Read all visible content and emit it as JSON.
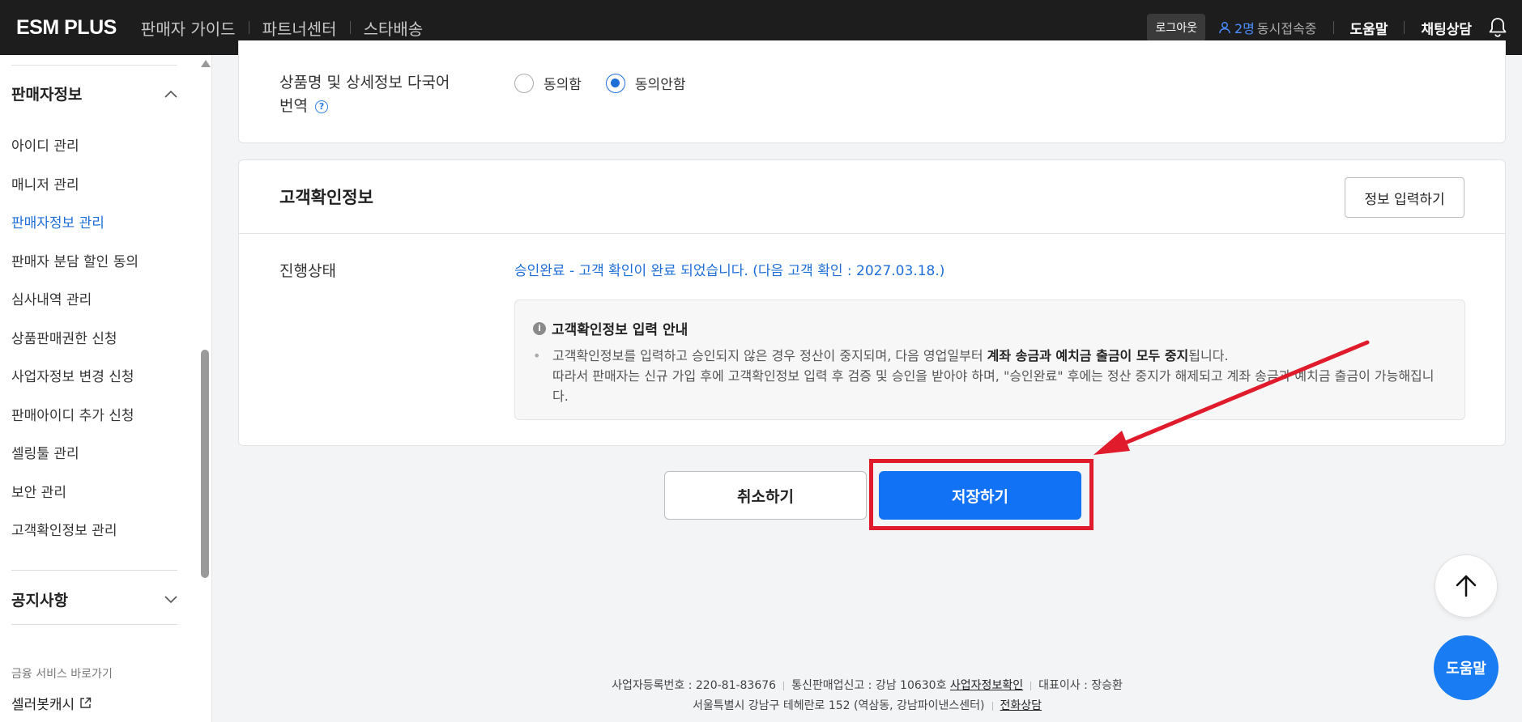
{
  "header": {
    "logo": "ESM PLUS",
    "nav": [
      "판매자 가이드",
      "파트너센터",
      "스타배송"
    ],
    "logout": "로그아웃",
    "session_count": "2명",
    "session_label": "동시접속중",
    "help": "도움말",
    "chat": "채팅상담"
  },
  "sidebar": {
    "section_title": "판매자정보",
    "items": [
      {
        "label": "아이디 관리"
      },
      {
        "label": "매니저 관리"
      },
      {
        "label": "판매자정보 관리"
      },
      {
        "label": "판매자 분담 할인 동의"
      },
      {
        "label": "심사내역 관리"
      },
      {
        "label": "상품판매권한 신청"
      },
      {
        "label": "사업자정보 변경 신청"
      },
      {
        "label": "판매아이디 추가 신청"
      },
      {
        "label": "셀링툴 관리"
      },
      {
        "label": "보안 관리"
      },
      {
        "label": "고객확인정보 관리"
      }
    ],
    "notice_title": "공지사항",
    "finance_label": "금융 서비스 바로가기",
    "finance_link": "셀러봇캐시"
  },
  "translation": {
    "label_line1": "상품명 및 상세정보 다국어",
    "label_line2": "번역",
    "options": [
      "동의함",
      "동의안함"
    ],
    "selected": "동의안함"
  },
  "customer_info": {
    "title": "고객확인정보",
    "input_button": "정보 입력하기",
    "status_label": "진행상태",
    "status_text": "승인완료 - 고객 확인이 완료 되었습니다. (다음 고객 확인 : 2027.03.18.)",
    "notice_title": "고객확인정보 입력 안내",
    "notice_part1": "고객확인정보를 입력하고 승인되지 않은 경우 정산이 중지되며, 다음 영업일부터 ",
    "notice_bold": "계좌 송금과 예치금 출금이 모두 중지",
    "notice_part2": "됩니다.",
    "notice_line2": "따라서 판매자는 신규 가입 후에 고객확인정보 입력 후 검증 및 승인을 받아야 하며, \"승인완료\" 후에는 정산 중지가 해제되고 계좌 송금과 예치금 출금이 가능해집니다."
  },
  "actions": {
    "cancel": "취소하기",
    "save": "저장하기"
  },
  "floating": {
    "help": "도움말"
  },
  "footer": {
    "biz_no": "사업자등록번호 : 220-81-83676",
    "mail_order": "통신판매업신고 : 강남 10630호",
    "biz_check": "사업자정보확인",
    "ceo": "대표이사 : 장승환",
    "address": "서울특별시 강남구 테헤란로 152 (역삼동, 강남파이낸스센터)",
    "phone": "전화상담"
  },
  "colors": {
    "accent": "#1272f5",
    "highlight": "#e01b2b",
    "header_bg": "#1d1d1d"
  }
}
